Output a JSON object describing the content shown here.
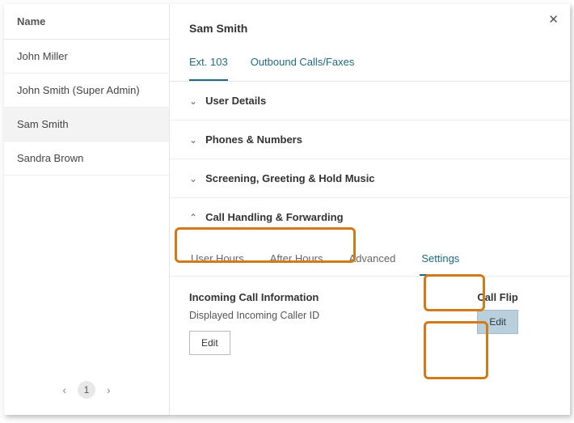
{
  "left": {
    "header": "Name",
    "users": [
      {
        "name": "John Miller",
        "active": false
      },
      {
        "name": "John Smith (Super Admin)",
        "active": false
      },
      {
        "name": "Sam Smith",
        "active": true
      },
      {
        "name": "Sandra Brown",
        "active": false
      }
    ],
    "pager": {
      "page": "1"
    }
  },
  "detail": {
    "title": "Sam Smith",
    "close": "✕",
    "tabs": {
      "ext": "Ext. 103",
      "outbound": "Outbound Calls/Faxes"
    },
    "accordions": {
      "user_details": "User Details",
      "phones": "Phones & Numbers",
      "screening": "Screening, Greeting & Hold Music",
      "call_handling": "Call Handling & Forwarding"
    },
    "subtabs": {
      "user_hours": "User Hours",
      "after_hours": "After Hours",
      "advanced": "Advanced",
      "settings": "Settings"
    },
    "incoming": {
      "header": "Incoming Call Information",
      "sub": "Displayed Incoming Caller ID",
      "edit": "Edit"
    },
    "callflip": {
      "header": "Call Flip",
      "edit": "Edit"
    }
  }
}
